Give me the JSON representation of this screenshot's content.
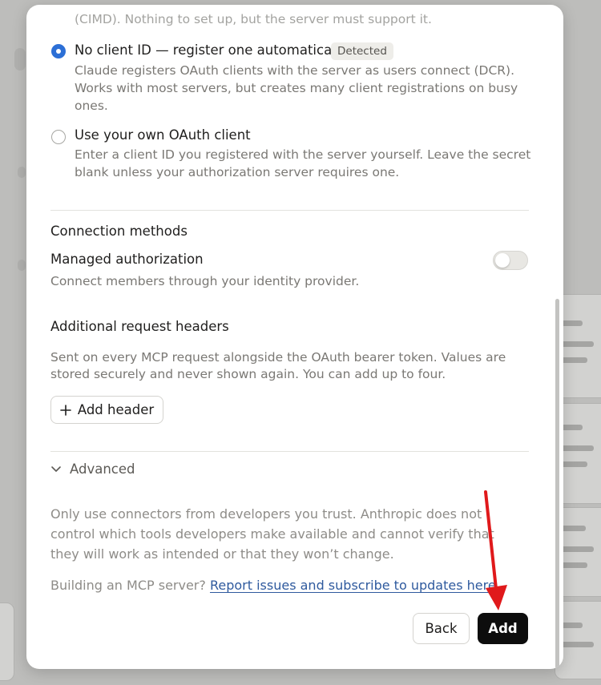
{
  "oauth_options": {
    "cimd_tail": "(CIMD). Nothing to set up, but the server must support it.",
    "dcr": {
      "title": "No client ID — register one automatically",
      "badge": "Detected",
      "description": "Claude registers OAuth clients with the server as users connect (DCR). Works with most servers, but creates many client registrations on busy ones."
    },
    "own_client": {
      "title": "Use your own OAuth client",
      "description": "Enter a client ID you registered with the server yourself. Leave the secret blank unless your authorization server requires one."
    }
  },
  "connection_methods": {
    "heading": "Connection methods",
    "managed_auth": {
      "title": "Managed authorization",
      "description": "Connect members through your identity provider.",
      "enabled": false
    }
  },
  "headers": {
    "heading": "Additional request headers",
    "description": "Sent on every MCP request alongside the OAuth bearer token. Values are stored securely and never shown again. You can add up to four.",
    "add_label": "Add header"
  },
  "advanced": {
    "label": "Advanced"
  },
  "disclaimer": "Only use connectors from developers you trust. Anthropic does not control which tools developers make available and cannot verify that they will work as intended or that they won’t change.",
  "mcp_footer": {
    "prefix": "Building an MCP server?",
    "link": "Report issues and subscribe to updates here"
  },
  "actions": {
    "back": "Back",
    "add": "Add"
  },
  "annotation": {
    "arrow_color": "#e0191b"
  },
  "icons": [
    "radio-checked-icon",
    "radio-unchecked-icon",
    "plus-icon",
    "chevron-down-icon",
    "toggle-switch"
  ]
}
